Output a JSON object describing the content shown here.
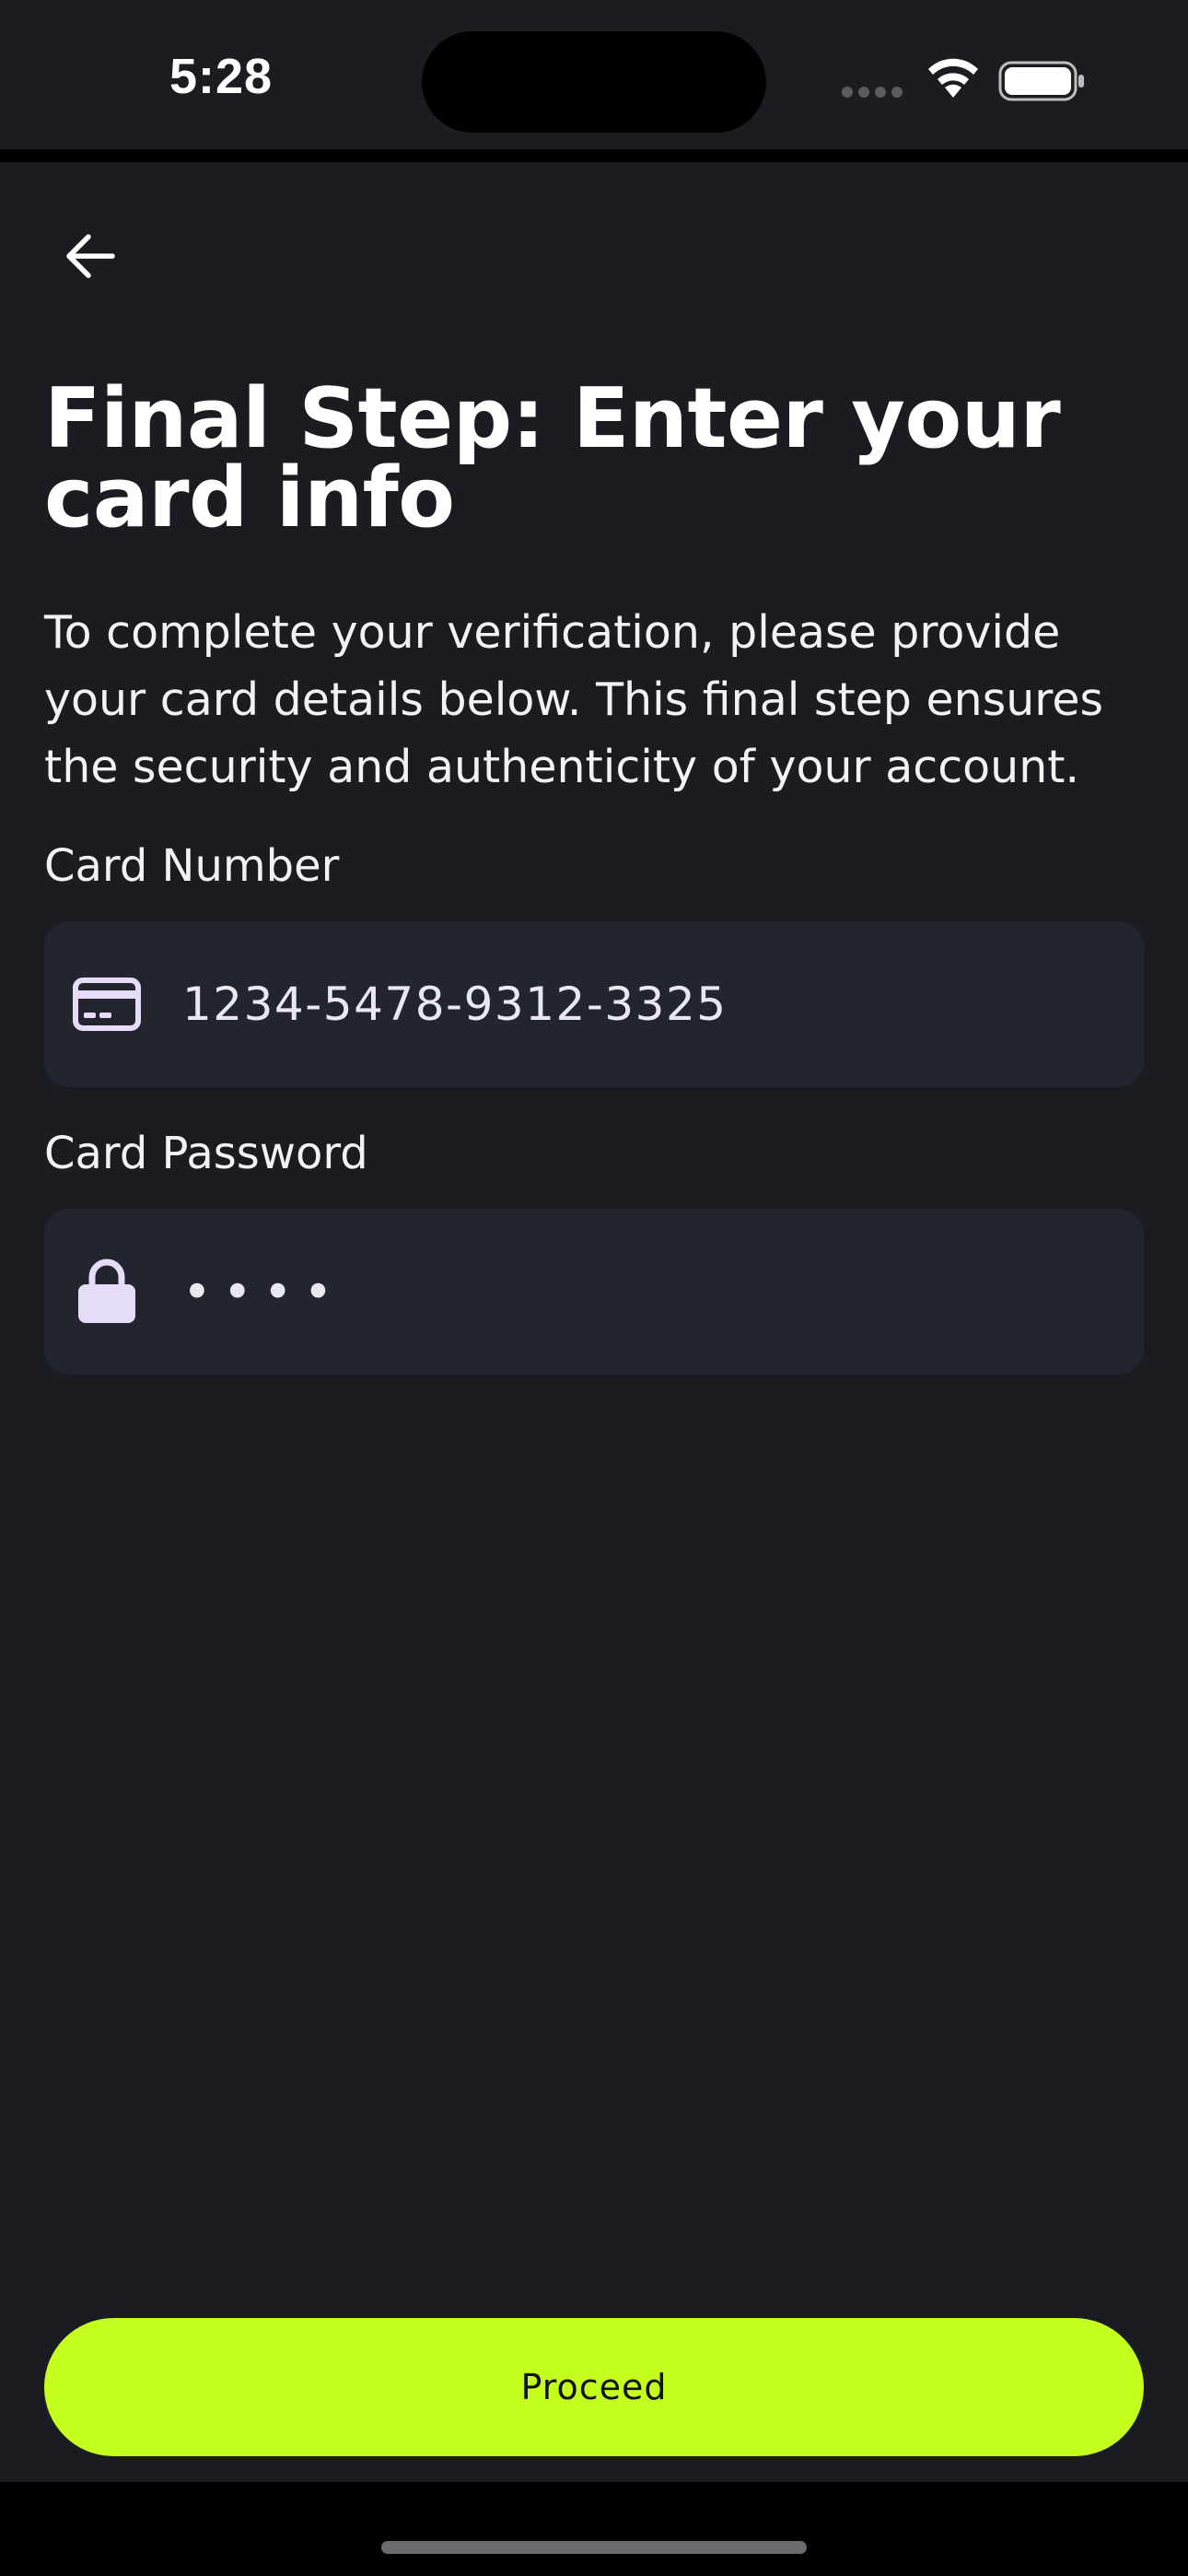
{
  "status_bar": {
    "time": "5:28"
  },
  "header": {
    "back_icon": "arrow-left-icon"
  },
  "main": {
    "title": "Final Step: Enter your card info",
    "description": "To complete your verification, please provide your card details below. This final step ensures the security and authenticity of your account.",
    "card_number": {
      "label": "Card Number",
      "icon": "credit-card-icon",
      "value": "1234-5478-9312-3325"
    },
    "card_password": {
      "label": "Card Password",
      "icon": "lock-icon",
      "value": "••••"
    },
    "proceed_label": "Proceed"
  },
  "colors": {
    "background": "#1b1c21",
    "field_background": "#22242e",
    "accent": "#c5ff1d",
    "icon_tint": "#e6dcfa"
  }
}
